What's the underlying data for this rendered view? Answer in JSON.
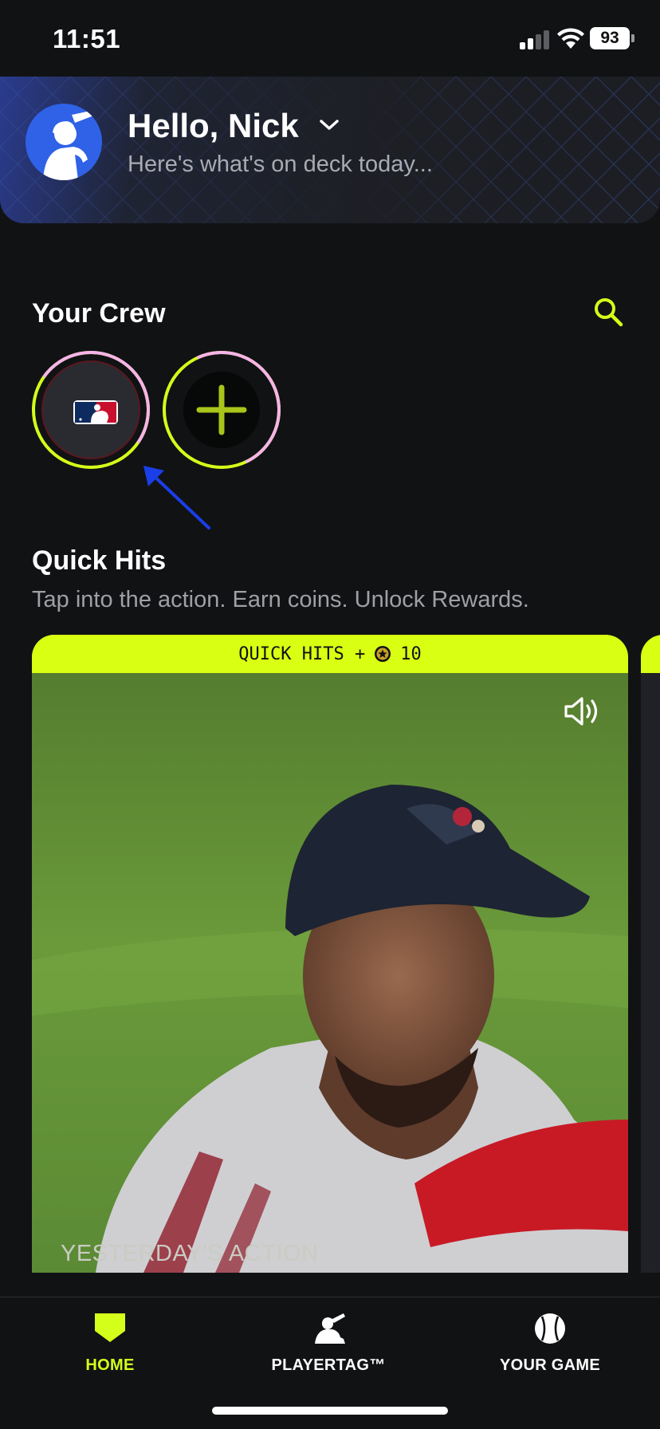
{
  "status_bar": {
    "time": "11:51",
    "battery": "93"
  },
  "header": {
    "greeting": "Hello, Nick",
    "subtitle": "Here's what's on deck today..."
  },
  "crew": {
    "title": "Your Crew",
    "items": [
      {
        "name": "MLB"
      },
      {
        "name": "add"
      }
    ]
  },
  "quick_hits": {
    "title": "Quick Hits",
    "subtitle": "Tap into the action. Earn coins. Unlock Rewards.",
    "card": {
      "banner_label": "QUICK HITS +",
      "coins": "10",
      "caption": "YESTERDAY'S ACTION"
    }
  },
  "nav": {
    "home": "HOME",
    "playertag": "PLAYERTAG™",
    "your_game": "YOUR GAME"
  },
  "colors": {
    "accent": "#d4ff1a",
    "background": "#111214",
    "header_blue": "#2a3b8e",
    "annotation_arrow": "#1a3ee8"
  }
}
